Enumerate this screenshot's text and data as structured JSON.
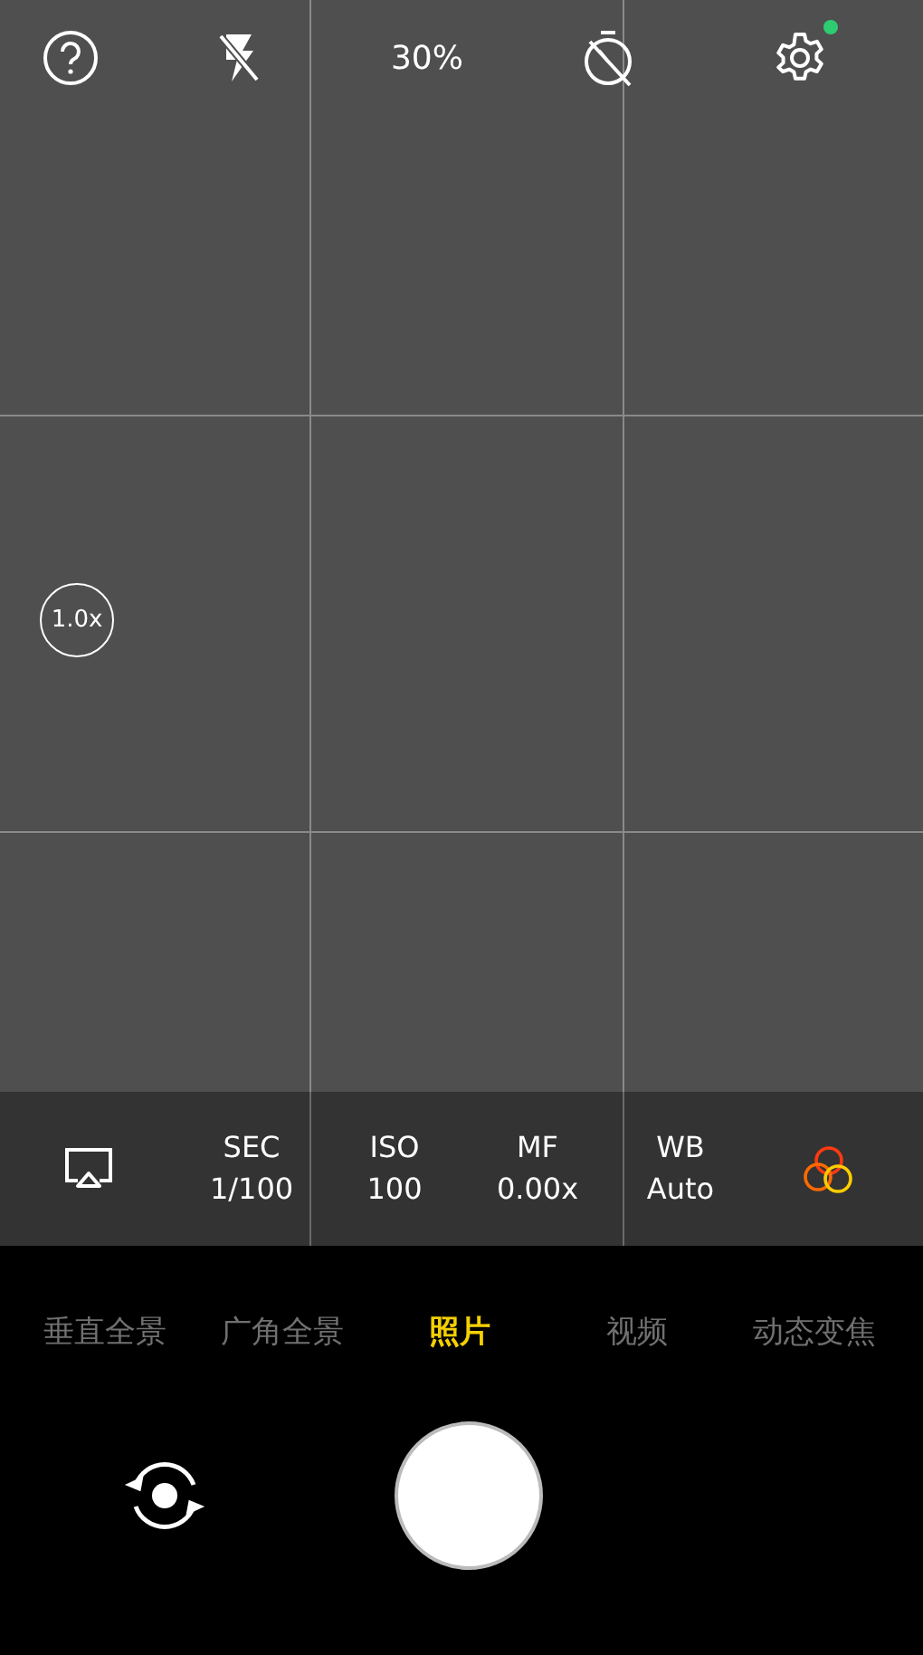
{
  "top_bar": {
    "zoom_percent": "30%",
    "settings_badge": true
  },
  "zoom_level": "1.0x",
  "params": [
    {
      "label": "SEC",
      "value": "1/100"
    },
    {
      "label": "ISO",
      "value": "100"
    },
    {
      "label": "MF",
      "value": "0.00x"
    },
    {
      "label": "WB",
      "value": "Auto"
    }
  ],
  "modes": [
    {
      "label": "垂直全景",
      "selected": false
    },
    {
      "label": "广角全景",
      "selected": false
    },
    {
      "label": "照片",
      "selected": true
    },
    {
      "label": "视频",
      "selected": false
    },
    {
      "label": "动态变焦",
      "selected": false
    }
  ]
}
